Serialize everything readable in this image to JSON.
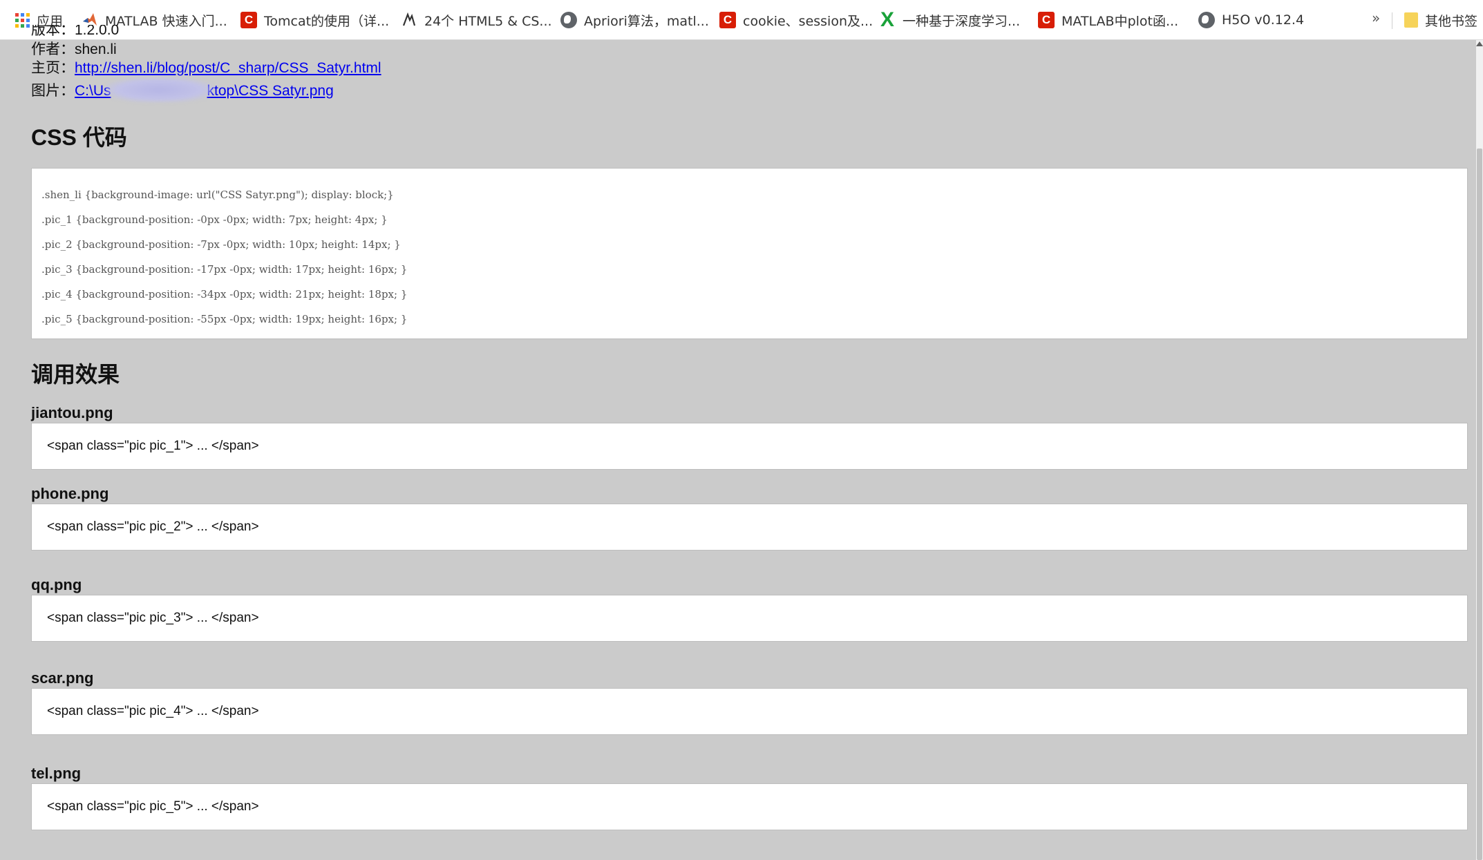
{
  "bookmarks": [
    {
      "label": "应用",
      "icon": "apps-grid-icon"
    },
    {
      "label": "MATLAB 快速入门...",
      "icon": "matlab-icon"
    },
    {
      "label": "Tomcat的使用（详...",
      "icon": "csdn-icon"
    },
    {
      "label": "24个 HTML5 & CS...",
      "icon": "bookmark-logo-icon"
    },
    {
      "label": "Apriori算法，matl...",
      "icon": "globe-icon"
    },
    {
      "label": "cookie、session及...",
      "icon": "csdn-icon"
    },
    {
      "label": "一种基于深度学习...",
      "icon": "x-logo-icon"
    },
    {
      "label": "MATLAB中plot函...",
      "icon": "csdn-icon"
    },
    {
      "label": "H5O v0.12.4",
      "icon": "globe-icon"
    }
  ],
  "bookmarks_more": "»",
  "other_bookmarks": "其他书签",
  "meta": {
    "version_cut": "版本：1.2.0.0",
    "author_label": "作者：",
    "author": "shen.li",
    "home_label": "主页：",
    "home_url": "http://shen.li/blog/post/C_sharp/CSS_Satyr.html",
    "image_label": "图片：",
    "image_path_start": "C:\\Us",
    "image_path_end": "ktop\\CSS Satyr.png"
  },
  "css_heading": "CSS 代码",
  "code_lines": [
    ".shen_li {background-image: url(\"CSS Satyr.png\"); display: block;}",
    ".pic_1 {background-position: -0px -0px; width: 7px; height: 4px; }",
    ".pic_2 {background-position: -7px -0px; width: 10px; height: 14px; }",
    ".pic_3 {background-position: -17px -0px; width: 17px; height: 16px; }",
    ".pic_4 {background-position: -34px -0px; width: 21px; height: 18px; }",
    ".pic_5 {background-position: -55px -0px; width: 19px; height: 16px; }"
  ],
  "usage_heading": "调用效果",
  "usages": [
    {
      "file": "jiantou.png",
      "code": "<span class=\"pic pic_1\"> ... </span>"
    },
    {
      "file": "phone.png",
      "code": "<span class=\"pic pic_2\"> ... </span>"
    },
    {
      "file": "qq.png",
      "code": "<span class=\"pic pic_3\"> ... </span>"
    },
    {
      "file": "scar.png",
      "code": "<span class=\"pic pic_4\"> ... </span>"
    },
    {
      "file": "tel.png",
      "code": "<span class=\"pic pic_5\"> ... </span>"
    }
  ],
  "colors": {
    "page_bg": "#cbcbcb",
    "link": "#0000ee",
    "csdn_red": "#d81e06",
    "x_green": "#1aa23a"
  }
}
